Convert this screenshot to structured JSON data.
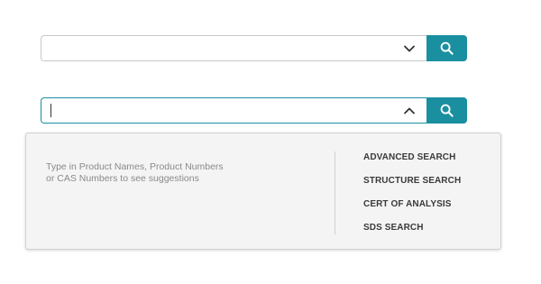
{
  "search_closed": {
    "value": "",
    "placeholder": "",
    "toggle_icon": "chevron-down-icon",
    "button_icon": "search-icon"
  },
  "search_open": {
    "value": "",
    "placeholder": "",
    "toggle_icon": "chevron-up-icon",
    "button_icon": "search-icon"
  },
  "dropdown": {
    "hint_line1": "Type in Product Names, Product Numbers",
    "hint_line2": "or CAS Numbers to see suggestions",
    "links": [
      {
        "label": "ADVANCED SEARCH"
      },
      {
        "label": "STRUCTURE SEARCH"
      },
      {
        "label": "CERT OF ANALYSIS"
      },
      {
        "label": "SDS SEARCH"
      }
    ]
  },
  "colors": {
    "accent": "#1a8fa0",
    "focus_border": "#1a8fa0",
    "panel_bg": "#f4f4f4",
    "hint_text": "#8a8a8a",
    "link_text": "#3a3a3a"
  }
}
